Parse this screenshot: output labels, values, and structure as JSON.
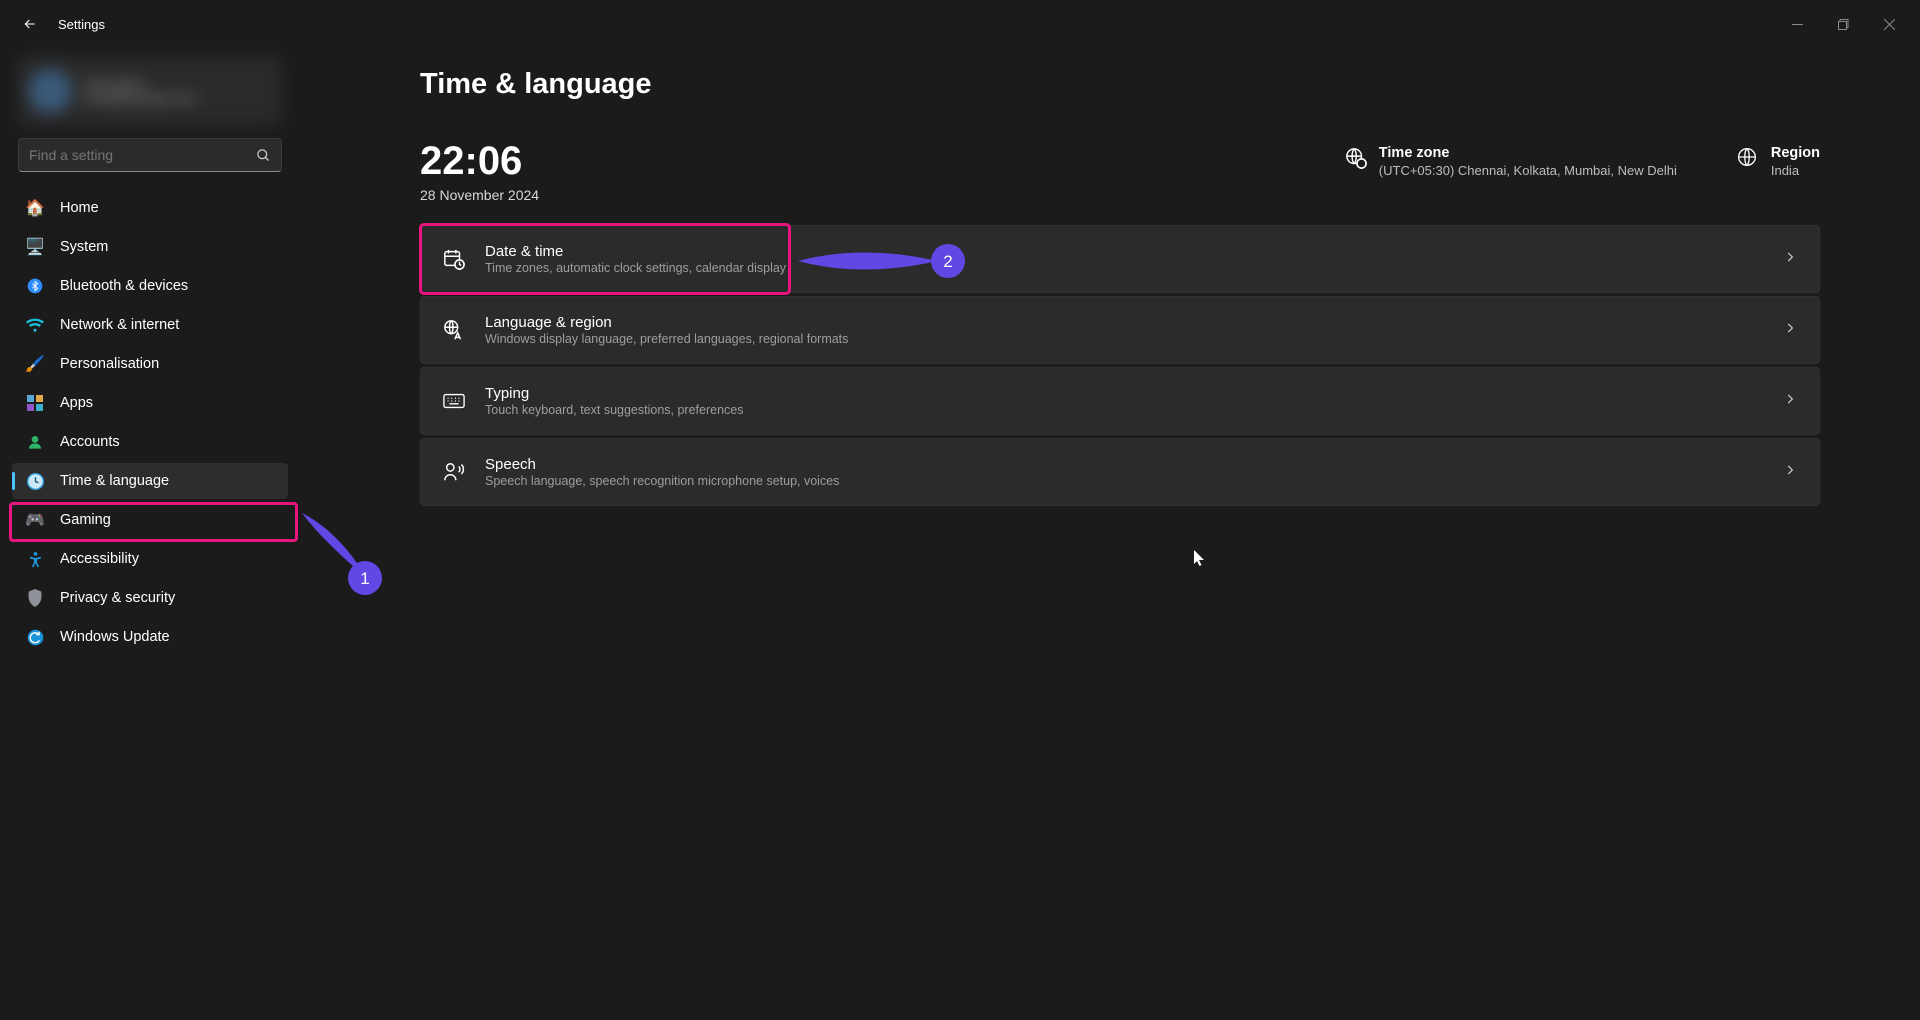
{
  "titlebar": {
    "title": "Settings"
  },
  "search": {
    "placeholder": "Find a setting"
  },
  "sidebar": {
    "items": [
      {
        "label": "Home",
        "icon": "home"
      },
      {
        "label": "System",
        "icon": "system"
      },
      {
        "label": "Bluetooth & devices",
        "icon": "bluetooth"
      },
      {
        "label": "Network & internet",
        "icon": "wifi"
      },
      {
        "label": "Personalisation",
        "icon": "brush"
      },
      {
        "label": "Apps",
        "icon": "apps"
      },
      {
        "label": "Accounts",
        "icon": "account"
      },
      {
        "label": "Time & language",
        "icon": "clock",
        "selected": true
      },
      {
        "label": "Gaming",
        "icon": "gaming"
      },
      {
        "label": "Accessibility",
        "icon": "accessibility"
      },
      {
        "label": "Privacy & security",
        "icon": "privacy"
      },
      {
        "label": "Windows Update",
        "icon": "update"
      }
    ]
  },
  "page": {
    "title": "Time & language",
    "time": "22:06",
    "date": "28 November 2024",
    "timezone_label": "Time zone",
    "timezone_value": "(UTC+05:30) Chennai, Kolkata, Mumbai, New Delhi",
    "region_label": "Region",
    "region_value": "India",
    "cards": [
      {
        "title": "Date & time",
        "sub": "Time zones, automatic clock settings, calendar display"
      },
      {
        "title": "Language & region",
        "sub": "Windows display language, preferred languages, regional formats"
      },
      {
        "title": "Typing",
        "sub": "Touch keyboard, text suggestions, preferences"
      },
      {
        "title": "Speech",
        "sub": "Speech language, speech recognition microphone setup, voices"
      }
    ]
  },
  "annotations": {
    "arrow1": "1",
    "arrow2": "2"
  },
  "icons": {
    "colors": {
      "home": "#d88b3a",
      "system": "#3fa7e0",
      "bluetooth": "#2d8cff",
      "wifi": "#18c1d9",
      "brush": "#8d6d51",
      "apps": "#5aa7d6",
      "account": "#2fb566",
      "clock": "#32a4e6",
      "gaming": "#9aa4c9",
      "accessibility": "#1e9be0",
      "privacy": "#8e9298",
      "update": "#1a93d6"
    }
  }
}
